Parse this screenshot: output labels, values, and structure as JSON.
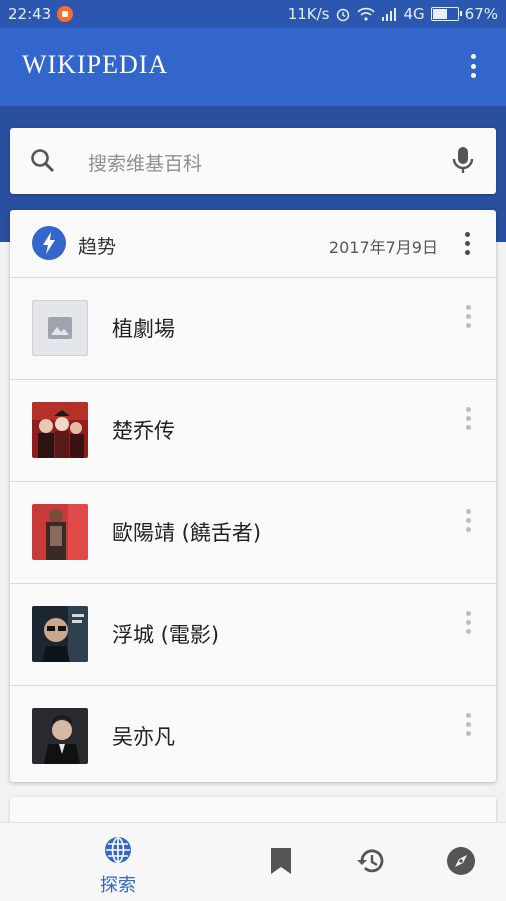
{
  "status_bar": {
    "time": "22:43",
    "speed": "11K/s",
    "network": "4G",
    "battery": "67%",
    "battery_level": 0.67
  },
  "app_bar": {
    "logo": "WIKIPEDIA"
  },
  "search": {
    "placeholder": "搜索维基百科"
  },
  "trending_card": {
    "title": "趋势",
    "date": "2017年7月9日",
    "items": [
      {
        "title": "植劇場",
        "thumb": "placeholder-image-icon"
      },
      {
        "title": "楚乔传",
        "thumb": "photo"
      },
      {
        "title": "歐陽靖 (饒舌者)",
        "thumb": "photo"
      },
      {
        "title": "浮城 (電影)",
        "thumb": "photo"
      },
      {
        "title": "吴亦凡",
        "thumb": "photo"
      }
    ]
  },
  "bottom_nav": {
    "explore_label": "探索",
    "items": [
      "globe-icon",
      "bookmark-icon",
      "history-icon",
      "compass-icon"
    ]
  },
  "colors": {
    "primary": "#3366cc",
    "status_bar": "#2b57b0",
    "band": "#2a4f9f"
  }
}
